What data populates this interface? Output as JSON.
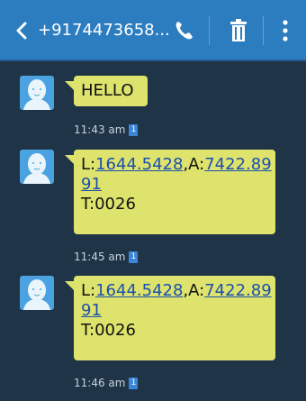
{
  "header": {
    "contact": "+9174473658...",
    "back_icon": "back-arrow-icon",
    "call_icon": "phone-icon",
    "delete_icon": "trash-icon",
    "more_icon": "more-vertical-icon",
    "color": "#2c7cc0"
  },
  "messages": [
    {
      "line1": "HELLO",
      "time": "11:43 am",
      "sim": "1"
    },
    {
      "l_prefix": "L:",
      "l_value": "1644.5428",
      "a_prefix": ",A:",
      "a_value_part1": "7422.89",
      "a_value_part2": "91",
      "t_line": "T:0026",
      "time": "11:45 am",
      "sim": "1"
    },
    {
      "l_prefix": "L:",
      "l_value": "1644.5428",
      "a_prefix": ",A:",
      "a_value_part1": "7422.89",
      "a_value_part2": "91",
      "t_line": "T:0026",
      "time": "11:46 am",
      "sim": "1"
    }
  ],
  "colors": {
    "background": "#1f3447",
    "bubble": "#dde36d",
    "link": "#1c4fb0"
  }
}
